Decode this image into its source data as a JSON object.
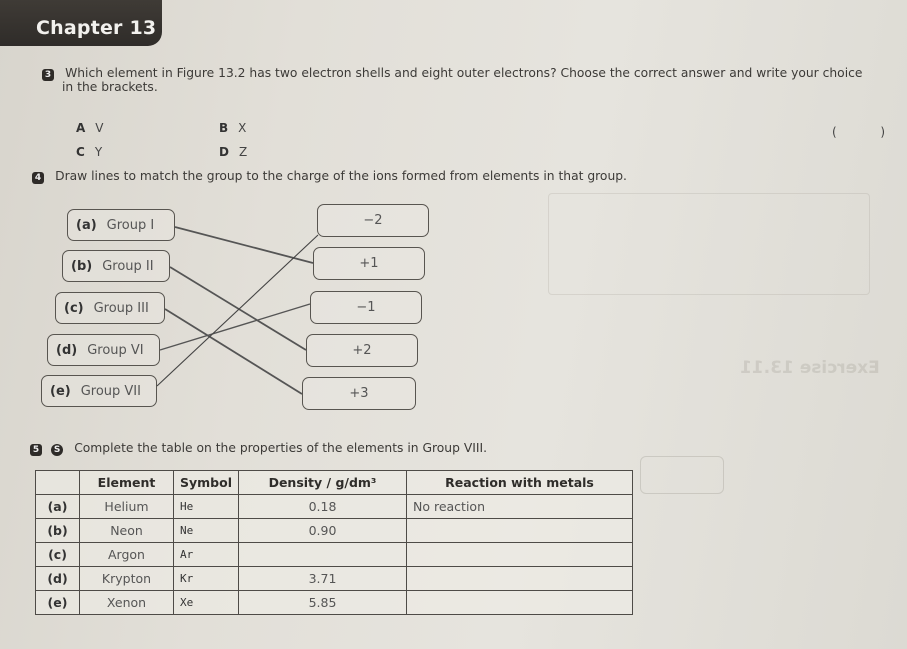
{
  "chapter": {
    "title": "Chapter 13"
  },
  "question3": {
    "number": "3",
    "text_line1": "Which element in Figure 13.2 has two electron shells and eight outer electrons? Choose the correct answer and write your choice",
    "text_line2": "in the brackets.",
    "options": [
      {
        "letter": "A",
        "value": "V"
      },
      {
        "letter": "B",
        "value": "X"
      },
      {
        "letter": "C",
        "value": "Y"
      },
      {
        "letter": "D",
        "value": "Z"
      }
    ],
    "answer_bracket_open": "(",
    "answer_bracket_close": ")",
    "answer": ""
  },
  "question4": {
    "number": "4",
    "text": "Draw lines to match the group to the charge of the ions formed from elements in that group.",
    "groups": [
      {
        "letter": "(a)",
        "label": "Group I"
      },
      {
        "letter": "(b)",
        "label": "Group II"
      },
      {
        "letter": "(c)",
        "label": "Group III"
      },
      {
        "letter": "(d)",
        "label": "Group VI"
      },
      {
        "letter": "(e)",
        "label": "Group VII"
      }
    ],
    "charges": [
      "−2",
      "+1",
      "−1",
      "+2",
      "+3"
    ],
    "drawn_matches": [
      {
        "group": "(a)",
        "charge": "+1"
      },
      {
        "group": "(b)",
        "charge": "+2"
      },
      {
        "group": "(c)",
        "charge": "+3"
      },
      {
        "group": "(d)",
        "charge": "−1"
      },
      {
        "group": "(e)",
        "charge": "−2"
      }
    ]
  },
  "question5": {
    "number": "5",
    "badge": "S",
    "text": "Complete the table on the properties of the elements in Group VIII.",
    "table": {
      "headers": [
        "",
        "Element",
        "Symbol",
        "Density / g/dm³",
        "Reaction with metals"
      ],
      "rows": [
        {
          "label": "(a)",
          "element": "Helium",
          "symbol": "He",
          "density": "0.18",
          "reaction": "No reaction"
        },
        {
          "label": "(b)",
          "element": "Neon",
          "symbol": "Ne",
          "density": "0.90",
          "reaction": ""
        },
        {
          "label": "(c)",
          "element": "Argon",
          "symbol": "Ar",
          "density": "",
          "reaction": ""
        },
        {
          "label": "(d)",
          "element": "Krypton",
          "symbol": "Kr",
          "density": "3.71",
          "reaction": ""
        },
        {
          "label": "(e)",
          "element": "Xenon",
          "symbol": "Xe",
          "density": "5.85",
          "reaction": ""
        }
      ]
    }
  },
  "background_ghost": {
    "exercise_label": "Exercise 13.11"
  }
}
